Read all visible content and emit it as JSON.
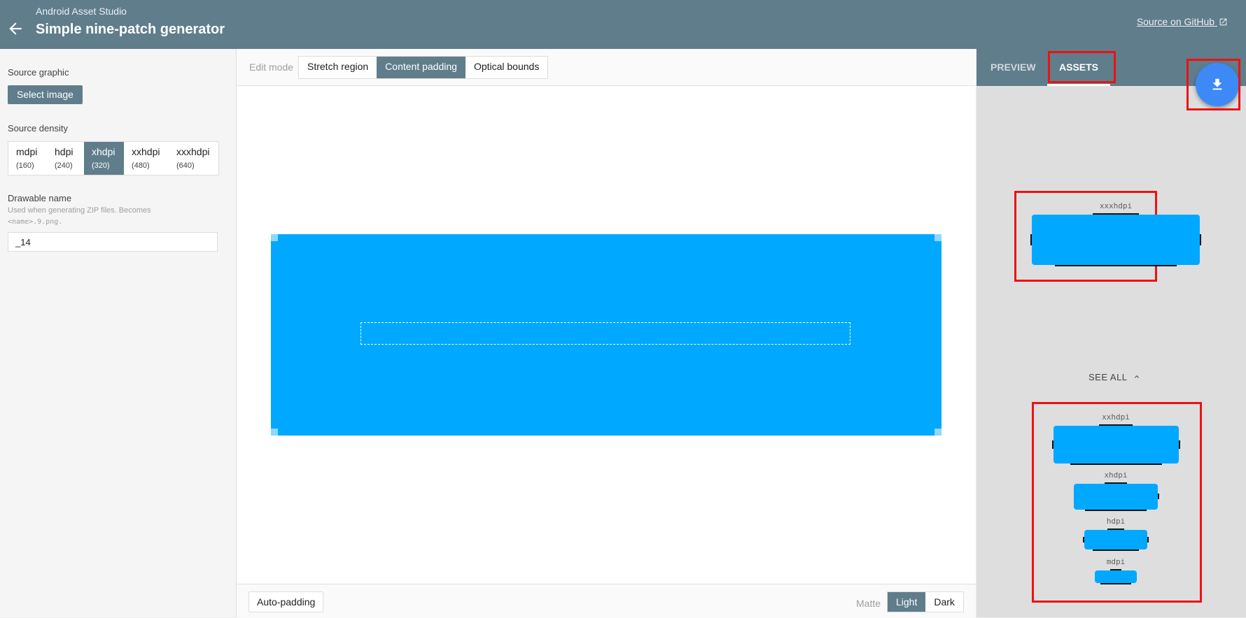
{
  "header": {
    "app_name": "Android Asset Studio",
    "title": "Simple nine-patch generator",
    "github_link": "Source on GitHub"
  },
  "form": {
    "source_graphic_label": "Source graphic",
    "select_image_label": "Select image",
    "source_density_label": "Source density",
    "densities": [
      {
        "name": "mdpi",
        "dpi": "(160)"
      },
      {
        "name": "hdpi",
        "dpi": "(240)"
      },
      {
        "name": "xhdpi",
        "dpi": "(320)"
      },
      {
        "name": "xxhdpi",
        "dpi": "(480)"
      },
      {
        "name": "xxxhdpi",
        "dpi": "(640)"
      }
    ],
    "selected_density": "xhdpi",
    "drawable_name_label": "Drawable name",
    "drawable_hint_line1": "Used when generating ZIP files. Becomes",
    "drawable_hint_code": "<name>.9.png.",
    "drawable_name_value": "_14"
  },
  "editor": {
    "edit_mode_label": "Edit mode",
    "modes": [
      "Stretch region",
      "Content padding",
      "Optical bounds"
    ],
    "selected_mode": "Content padding",
    "auto_padding_label": "Auto-padding",
    "matte_label": "Matte",
    "matte_options": [
      "Light",
      "Dark"
    ],
    "selected_matte": "Light",
    "image_color": "#00a8ff"
  },
  "panel": {
    "tabs": [
      "PREVIEW",
      "ASSETS"
    ],
    "active_tab": "ASSETS",
    "see_all_label": "SEE ALL",
    "assets": [
      "xxxhdpi",
      "xxhdpi",
      "xhdpi",
      "hdpi",
      "mdpi"
    ]
  },
  "colors": {
    "appbar": "#607d8b",
    "accent": "#3d8af7",
    "highlight": "#ee1111"
  }
}
